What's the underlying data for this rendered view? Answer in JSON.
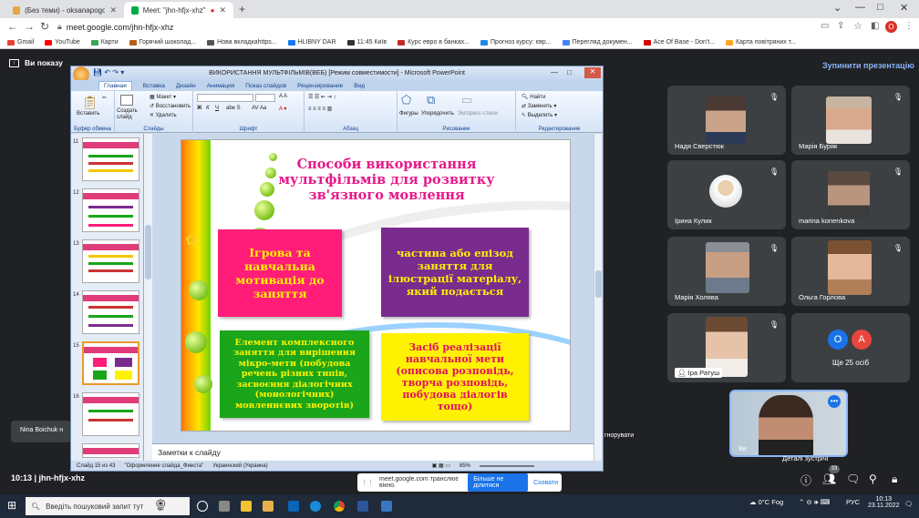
{
  "browser": {
    "tabs": [
      {
        "label": "(Без теми) - oksanapogorelko@..."
      },
      {
        "label": "Meet: \"jhn-hfjx-xhz\""
      }
    ],
    "url": "meet.google.com/jhn-hfjx-xhz",
    "bookmarks": [
      "Gmail",
      "YouTube",
      "Карти",
      "Горячий шоколад...",
      "Нова вкладкаhttps...",
      "HLIBNY DAR",
      "11:45 Київ",
      "Курс евро в банках...",
      "Прогноз курсу: євр...",
      "Перегляд докумен...",
      "Ace Of Base - Don't...",
      "Карта повітряних т..."
    ]
  },
  "meet": {
    "presenting_text": "Ви показу",
    "stop_presenting": "Зупинити презентацію",
    "participants": [
      {
        "name": "Надя Сверстюк"
      },
      {
        "name": "Марія Буряк"
      },
      {
        "name": "Ірина Кулик"
      },
      {
        "name": "marina konenkova"
      },
      {
        "name": "Марія Холява"
      },
      {
        "name": "Ольга Горлова"
      },
      {
        "name": "Іра Ратуш"
      },
      {
        "name": "Ще 25 осіб",
        "initials": [
          "О",
          "А"
        ]
      }
    ],
    "side_label": "Nina Boichuk н",
    "ignore_label": "гнорувати",
    "self_label": "Ви",
    "details_label": "Деталі зустрічі",
    "meeting_time_code": "10:13  |  jhn-hfjx-xhz",
    "people_count": "33",
    "popup": {
      "text": "meet.google.com транслює вікно.",
      "share_stop": "Більше не ділитися",
      "hide": "Сховати"
    }
  },
  "ppt": {
    "title": "ВИКОРИСТАННЯ МУЛЬТФІЛЬМІВ(ВЕБ) [Режим совместимости] - Microsoft PowerPoint",
    "tabs": [
      "Главная",
      "Вставка",
      "Дизайн",
      "Анимация",
      "Показ слайдов",
      "Рецензирование",
      "Вид"
    ],
    "ribbon": {
      "paste": "Вставить",
      "clipboard": "Буфер обмена",
      "create_slide": "Создать слайд",
      "layout": "Макет",
      "restore": "Восстановить",
      "delete": "Удалить",
      "slides": "Слайды",
      "font": "Шрифт",
      "paragraph": "Абзац",
      "shapes": "Фигуры",
      "arrange": "Упорядочить",
      "quick_styles": "Экспресс-стили",
      "drawing": "Рисование",
      "find": "Найти",
      "replace": "Заменить",
      "select": "Выделить",
      "editing": "Редактирование"
    },
    "thumb_numbers": [
      "11",
      "12",
      "13",
      "14",
      "15",
      "16"
    ],
    "notes": "Заметки к слайду",
    "status": {
      "slide": "Слайд 15 из 43",
      "theme": "\"Оформление слайда_Фиеста\"",
      "lang": "Украинский (Украина)",
      "zoom": "85%"
    },
    "slide": {
      "title": "Способи використання мультфільмів для розвитку зв'язного мовлення",
      "box1": "Ігрова та навчальна мотивація до заняття",
      "box2": "частина або епізод заняття для ілюстрації матеріалу, який подається",
      "box3": "Елемент комплексного заняття для вирішення мікро-мети (побудова речень різних типів, засвоєння діалогічних (монологічних) мовленнєвих зворотів)",
      "box4": "Засіб реалізації навчальної мети (описова розповідь, творча розповідь, побудова діалогів тощо)"
    }
  },
  "taskbar": {
    "search_placeholder": "Введіть пошуковий запит тут",
    "weather": "0°C Fog",
    "lang": "РУС",
    "time": "10:13",
    "date": "23.11.2022"
  },
  "colors": {
    "box1": "#ff1d79",
    "box2": "#7a2c8e",
    "box3": "#1aa51a",
    "box4": "#fff200",
    "title_pink": "#e6198a",
    "meet_blue": "#8ab4f8"
  }
}
